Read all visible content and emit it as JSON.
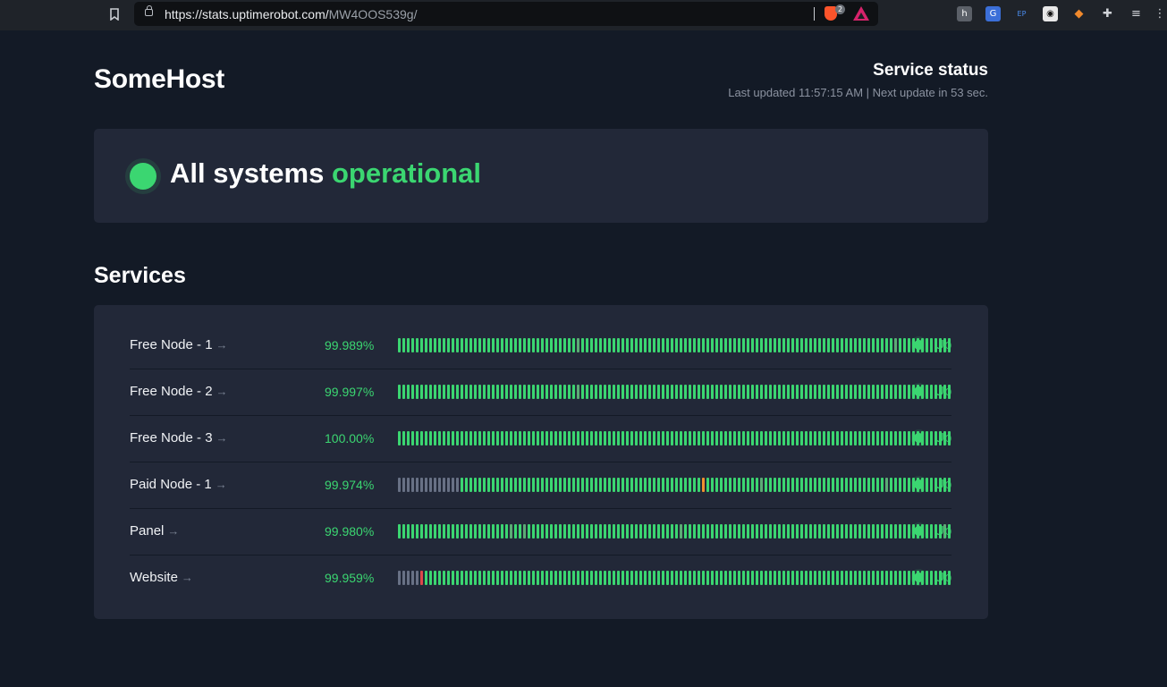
{
  "browser": {
    "url_host": "https://stats.uptimerobot.com/",
    "url_path": "MW4OOS539g/",
    "brave_badge": "2"
  },
  "header": {
    "site_title": "SomeHost",
    "status_title": "Service status",
    "updated_text": "Last updated 11:57:15 AM | Next update in 53 sec."
  },
  "banner": {
    "text_main": "All systems",
    "text_status": "operational"
  },
  "services_title": "Services",
  "colors": {
    "up": "#3bd671",
    "nodata": "#687185",
    "partial": "#5bac75",
    "warning": "#f29030",
    "down": "#df484a"
  },
  "services": [
    {
      "name": "Free Node - 1",
      "arrow": "→",
      "uptime": "99.989%",
      "status": "Up",
      "bar_runs": [
        [
          "u",
          40
        ],
        [
          "p",
          1
        ],
        [
          "u",
          70
        ],
        [
          "p",
          1
        ],
        [
          "u",
          12
        ]
      ]
    },
    {
      "name": "Free Node - 2",
      "arrow": "→",
      "uptime": "99.997%",
      "status": "Up",
      "bar_runs": [
        [
          "u",
          40
        ],
        [
          "p",
          1
        ],
        [
          "u",
          83
        ]
      ]
    },
    {
      "name": "Free Node - 3",
      "arrow": "→",
      "uptime": "100.00%",
      "status": "Up",
      "bar_runs": [
        [
          "u",
          124
        ]
      ]
    },
    {
      "name": "Paid Node - 1",
      "arrow": "→",
      "uptime": "99.974%",
      "status": "Up",
      "bar_runs": [
        [
          "n",
          14
        ],
        [
          "u",
          54
        ],
        [
          "w",
          1
        ],
        [
          "u",
          12
        ],
        [
          "p",
          1
        ],
        [
          "u",
          27
        ],
        [
          "p",
          1
        ],
        [
          "u",
          14
        ]
      ]
    },
    {
      "name": "Panel",
      "arrow": "→",
      "uptime": "99.980%",
      "status": "Up",
      "bar_runs": [
        [
          "u",
          25
        ],
        [
          "p",
          1
        ],
        [
          "u",
          2
        ],
        [
          "p",
          1
        ],
        [
          "u",
          34
        ],
        [
          "p",
          1
        ],
        [
          "u",
          58
        ],
        [
          "p",
          1
        ],
        [
          "u",
          1
        ]
      ]
    },
    {
      "name": "Website",
      "arrow": "→",
      "uptime": "99.959%",
      "status": "Up",
      "bar_runs": [
        [
          "n",
          5
        ],
        [
          "d",
          1
        ],
        [
          "u",
          118
        ]
      ]
    }
  ]
}
